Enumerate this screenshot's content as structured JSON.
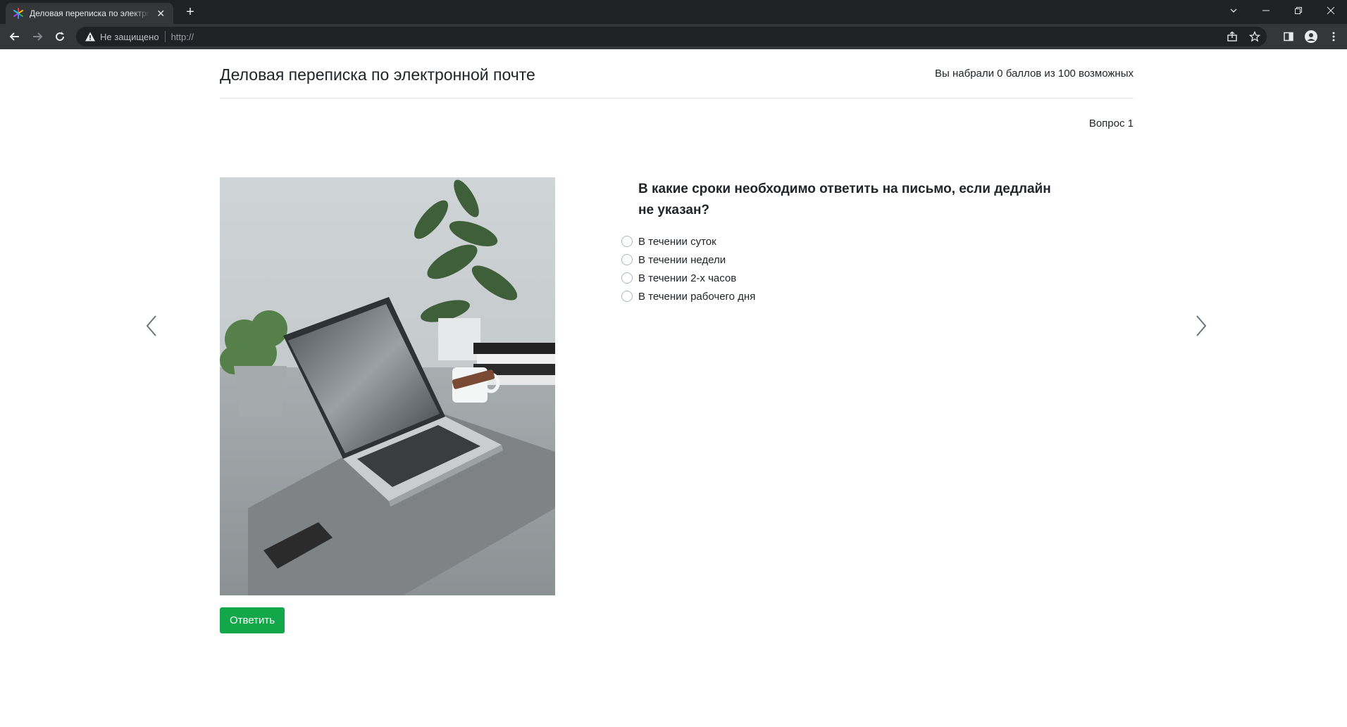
{
  "browser": {
    "tab_title": "Деловая переписка по электронной почте",
    "security_label": "Не защищено",
    "url": "http://"
  },
  "header": {
    "title": "Деловая переписка по электронной почте",
    "score_text": "Вы набрали 0 баллов из 100 возможных"
  },
  "question": {
    "number_label": "Вопрос 1",
    "text": "В какие сроки необходимо ответить на письмо, если дедлайн не указан?",
    "options": [
      "В течении суток",
      "В течении недели",
      "В течении 2-х часов",
      "В течении рабочего дня"
    ]
  },
  "actions": {
    "submit_label": "Ответить"
  },
  "colors": {
    "accent_green": "#12a84a",
    "chrome_dark": "#202124",
    "chrome_toolbar": "#35363a"
  }
}
